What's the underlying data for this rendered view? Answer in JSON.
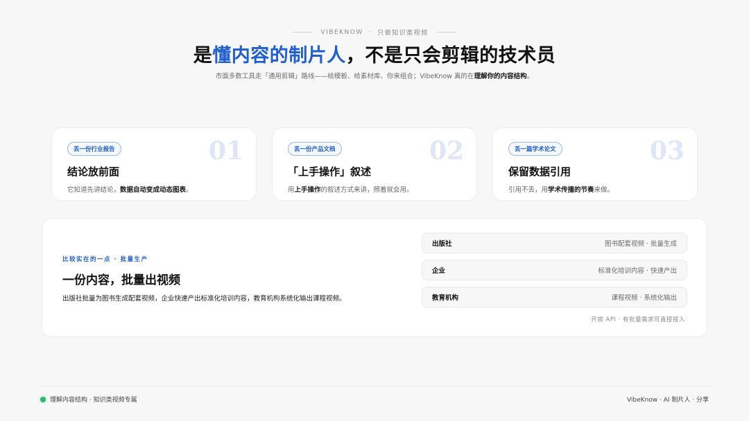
{
  "top": {
    "brand": "VIBEKNOW",
    "separator": "·",
    "tagline": "只做知识类视频"
  },
  "headline": {
    "prefix": "是",
    "accent": "懂内容的制片人",
    "suffix": "，不是只会剪辑的技术员"
  },
  "subline": {
    "text": "市面多数工具走「通用剪辑」路线——给模板、给素材库、你来组合；VibeKnow 真的在",
    "bold": "理解你的内容结构",
    "end": "。"
  },
  "cards": [
    {
      "badge": "丢一份行业报告",
      "num": "01",
      "title": "结论放前面",
      "desc_pre": "它知道先讲结论，",
      "desc_bold": "数据自动变成动态图表",
      "desc_post": "。"
    },
    {
      "badge": "丢一份产品文档",
      "num": "02",
      "title": "「上手操作」叙述",
      "desc_pre": "用",
      "desc_bold": "上手操作",
      "desc_post": "的叙述方式来讲，照着就会用。"
    },
    {
      "badge": "丢一篇学术论文",
      "num": "03",
      "title": "保留数据引用",
      "desc_pre": "引用不丢，用",
      "desc_bold": "学术传播的节奏",
      "desc_post": "来做。"
    }
  ],
  "panel": {
    "kicker": "比较实在的一点 · 批量生产",
    "title": "一份内容，批量出视频",
    "desc": "出版社批量为图书生成配套视频，企业快速产出标准化培训内容，教育机构系统化输出课程视频。",
    "rows": [
      {
        "label": "出版社",
        "value": "图书配套视频 · 批量生成"
      },
      {
        "label": "企业",
        "value": "标准化培训内容 · 快速产出"
      },
      {
        "label": "教育机构",
        "value": "课程视频 · 系统化输出"
      }
    ],
    "api_note": "开放 API · 有批量需求可直接接入"
  },
  "footer": {
    "left": "理解内容结构 · 知识类视频专属",
    "right": "VibeKnow · AI 制片人 · 分享"
  },
  "colors": {
    "accent": "#1f5fd1",
    "status_dot": "#2bb673"
  }
}
